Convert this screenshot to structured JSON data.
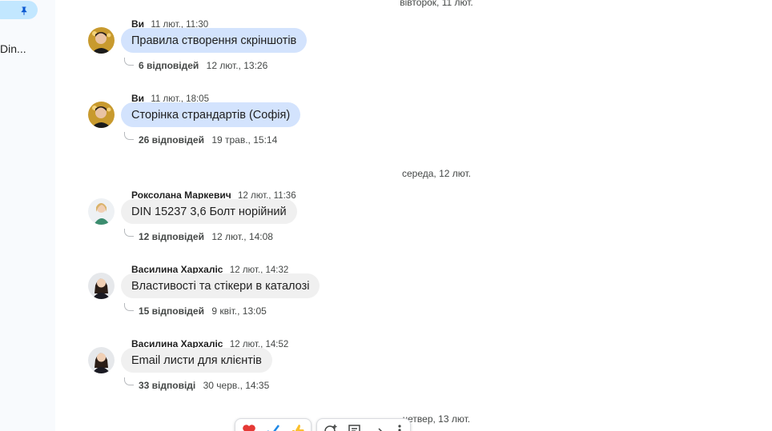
{
  "sidebar": {
    "pinned_icon": "pin-icon",
    "truncated_item": "Din..."
  },
  "date_dividers": [
    "вівторок, 11 лют.",
    "середа, 12 лют.",
    "четвер, 13 лют."
  ],
  "messages": [
    {
      "author": "Ви",
      "time": "11 лют., 11:30",
      "text": "Правила створення скріншотів",
      "replies": "6 відповідей",
      "last_reply": "12 лют., 13:26",
      "own": true
    },
    {
      "author": "Ви",
      "time": "11 лют., 18:05",
      "text": "Сторінка страндартів (Софія)",
      "replies": "26 відповідей",
      "last_reply": "19 трав., 15:14",
      "own": true
    },
    {
      "author": "Роксолана Маркевич",
      "time": "12 лют., 11:36",
      "text": "DIN 15237 3,6 Болт норійний",
      "replies": "12 відповідей",
      "last_reply": "12 лют., 14:08",
      "own": false
    },
    {
      "author": "Василина Хархаліс",
      "time": "12 лют., 14:32",
      "text": "Властивості та стікери в каталозі",
      "replies": "15 відповідей",
      "last_reply": "9 квіт., 13:05",
      "own": false
    },
    {
      "author": "Василина Хархаліс",
      "time": "12 лют., 14:52",
      "text": "Email листи для клієнтів",
      "replies": "33 відповіді",
      "last_reply": "30 черв., 14:35",
      "own": false
    }
  ],
  "reaction_toolbar": {
    "reactions": [
      "heart-icon",
      "check-icon",
      "thumbs-up-icon"
    ],
    "actions": [
      "add-reaction-icon",
      "reply-in-thread-icon",
      "forward-icon",
      "more-icon"
    ]
  },
  "colors": {
    "own_bubble": "#d3e3fd",
    "other_bubble": "#f0f0f0",
    "sidebar_bg": "#f8fafd",
    "pill": "#c2e7ff",
    "accent": "#0b57d0"
  }
}
